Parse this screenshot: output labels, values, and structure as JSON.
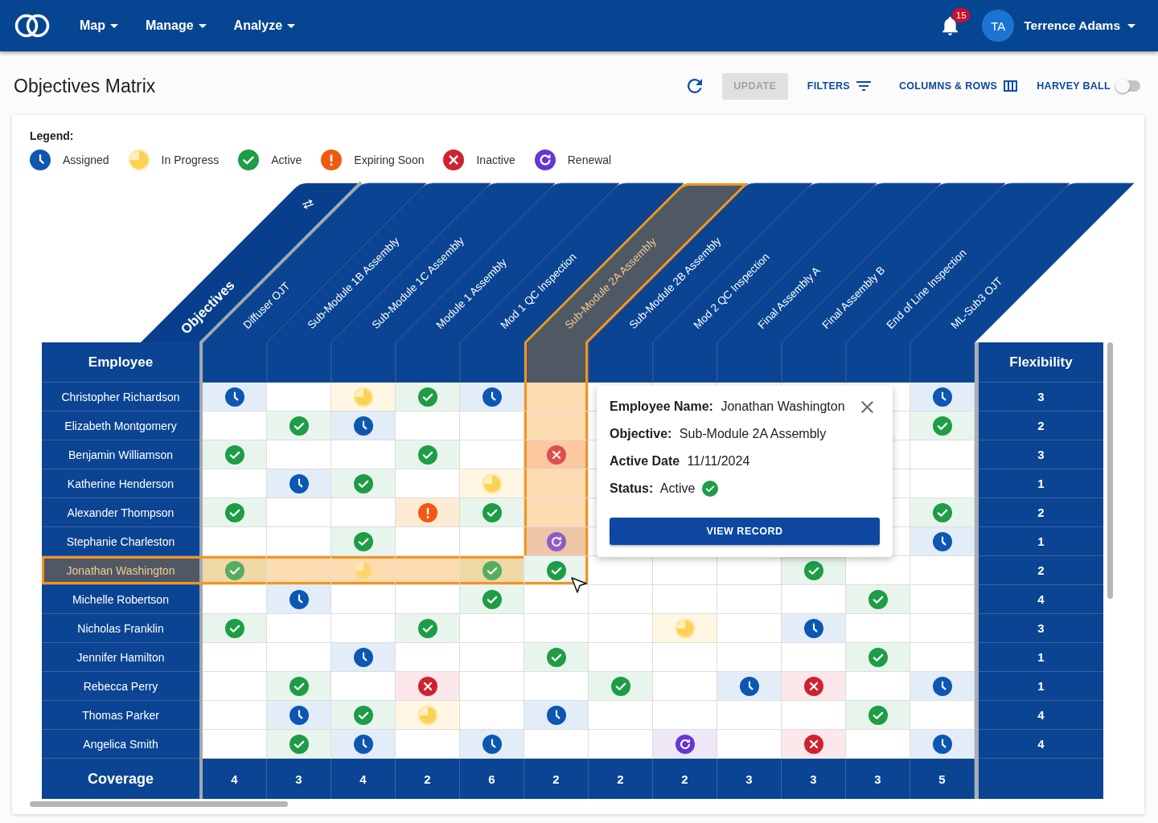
{
  "top_bar": {
    "nav": [
      "Map",
      "Manage",
      "Analyze"
    ],
    "notifications": "15",
    "user": {
      "initials": "TA",
      "name": "Terrence Adams"
    }
  },
  "page_title": "Objectives Matrix",
  "toolbar": {
    "update": {
      "label": "UPDATE",
      "disabled": true
    },
    "filters": "FILTERS",
    "columns_rows": "COLUMNS & ROWS",
    "harvey_ball": {
      "label": "HARVEY BALL",
      "on": false
    }
  },
  "legend": {
    "title": "Legend:",
    "items": [
      {
        "kind": "assigned",
        "label": "Assigned"
      },
      {
        "kind": "in_progress",
        "label": "In Progress"
      },
      {
        "kind": "active",
        "label": "Active"
      },
      {
        "kind": "expiring",
        "label": "Expiring Soon"
      },
      {
        "kind": "inactive",
        "label": "Inactive"
      },
      {
        "kind": "renewal",
        "label": "Renewal"
      }
    ]
  },
  "matrix": {
    "objectives_label": "Objectives",
    "employee_header": "Employee",
    "flexibility_header": "Flexibility",
    "columns": [
      {
        "label": "Diffuser OJT",
        "selected": false
      },
      {
        "label": "Sub-Module 1B Assembly",
        "selected": false
      },
      {
        "label": "Sub-Module 1C Assembly",
        "selected": false
      },
      {
        "label": "Module 1 Assembly",
        "selected": false
      },
      {
        "label": "Mod 1 QC Inspection",
        "selected": false
      },
      {
        "label": "Sub-Module 2A Assembly",
        "selected": true
      },
      {
        "label": "Sub-Module 2B Assembly",
        "selected": false
      },
      {
        "label": "Mod 2 QC Inspection",
        "selected": false
      },
      {
        "label": "Final Assembly A",
        "selected": false
      },
      {
        "label": "Final Assembly B",
        "selected": false
      },
      {
        "label": "End of Line Inspection",
        "selected": false
      },
      {
        "label": "ML-Sub3 OJT",
        "selected": false
      }
    ],
    "rows": [
      {
        "name": "Christopher Richardson",
        "selected": false,
        "cells": [
          {
            "kind": "assigned"
          },
          null,
          {
            "kind": "in_progress"
          },
          {
            "kind": "active"
          },
          {
            "kind": "assigned"
          },
          null,
          null,
          null,
          null,
          null,
          null,
          {
            "kind": "assigned"
          }
        ],
        "flexibility": "3"
      },
      {
        "name": "Elizabeth Montgomery",
        "selected": false,
        "cells": [
          null,
          {
            "kind": "active"
          },
          {
            "kind": "assigned"
          },
          null,
          null,
          null,
          null,
          null,
          null,
          null,
          null,
          {
            "kind": "active"
          }
        ],
        "flexibility": "2"
      },
      {
        "name": "Benjamin Williamson",
        "selected": false,
        "cells": [
          {
            "kind": "active"
          },
          null,
          null,
          {
            "kind": "active"
          },
          null,
          {
            "kind": "inactive"
          },
          null,
          null,
          null,
          null,
          null,
          null
        ],
        "flexibility": "3"
      },
      {
        "name": "Katherine Henderson",
        "selected": false,
        "cells": [
          null,
          {
            "kind": "assigned"
          },
          {
            "kind": "active"
          },
          null,
          {
            "kind": "in_progress"
          },
          null,
          null,
          null,
          null,
          null,
          null,
          null
        ],
        "flexibility": "1"
      },
      {
        "name": "Alexander Thompson",
        "selected": false,
        "cells": [
          {
            "kind": "active"
          },
          null,
          null,
          {
            "kind": "expiring"
          },
          {
            "kind": "active"
          },
          null,
          null,
          null,
          null,
          null,
          null,
          {
            "kind": "active"
          }
        ],
        "flexibility": "2"
      },
      {
        "name": "Stephanie Charleston",
        "selected": false,
        "cells": [
          null,
          null,
          {
            "kind": "active"
          },
          null,
          null,
          {
            "kind": "renewal"
          },
          null,
          null,
          null,
          null,
          null,
          {
            "kind": "assigned"
          }
        ],
        "flexibility": "1"
      },
      {
        "name": "Jonathan Washington",
        "selected": true,
        "cells": [
          {
            "kind": "active"
          },
          null,
          {
            "kind": "in_progress"
          },
          null,
          {
            "kind": "active"
          },
          {
            "kind": "active"
          },
          null,
          null,
          null,
          {
            "kind": "active"
          },
          null,
          null
        ],
        "flexibility": "2"
      },
      {
        "name": "Michelle Robertson",
        "selected": false,
        "cells": [
          null,
          {
            "kind": "assigned"
          },
          null,
          null,
          {
            "kind": "active"
          },
          null,
          null,
          null,
          null,
          null,
          {
            "kind": "active"
          },
          null
        ],
        "flexibility": "4"
      },
      {
        "name": "Nicholas Franklin",
        "selected": false,
        "cells": [
          {
            "kind": "active"
          },
          null,
          null,
          {
            "kind": "active"
          },
          null,
          null,
          null,
          {
            "kind": "in_progress"
          },
          null,
          {
            "kind": "assigned"
          },
          null,
          null
        ],
        "flexibility": "3"
      },
      {
        "name": "Jennifer Hamilton",
        "selected": false,
        "cells": [
          null,
          null,
          {
            "kind": "assigned"
          },
          null,
          null,
          {
            "kind": "active"
          },
          null,
          null,
          null,
          null,
          {
            "kind": "active"
          },
          null
        ],
        "flexibility": "1"
      },
      {
        "name": "Rebecca Perry",
        "selected": false,
        "cells": [
          null,
          {
            "kind": "active"
          },
          null,
          {
            "kind": "inactive"
          },
          null,
          null,
          {
            "kind": "active"
          },
          null,
          {
            "kind": "assigned"
          },
          {
            "kind": "inactive"
          },
          null,
          {
            "kind": "assigned"
          }
        ],
        "flexibility": "1"
      },
      {
        "name": "Thomas Parker",
        "selected": false,
        "cells": [
          null,
          {
            "kind": "assigned"
          },
          {
            "kind": "active"
          },
          {
            "kind": "in_progress"
          },
          null,
          {
            "kind": "assigned"
          },
          null,
          null,
          null,
          null,
          {
            "kind": "active"
          },
          null
        ],
        "flexibility": "4"
      },
      {
        "name": "Angelica Smith",
        "selected": false,
        "cells": [
          null,
          {
            "kind": "active"
          },
          {
            "kind": "assigned"
          },
          null,
          {
            "kind": "assigned"
          },
          null,
          null,
          {
            "kind": "renewal"
          },
          null,
          {
            "kind": "inactive"
          },
          null,
          {
            "kind": "assigned"
          }
        ],
        "flexibility": "4"
      }
    ],
    "coverage": {
      "label": "Coverage",
      "values": [
        "4",
        "3",
        "4",
        "2",
        "6",
        "2",
        "2",
        "2",
        "3",
        "3",
        "3",
        "5"
      ]
    }
  },
  "detail_popup": {
    "fields": [
      {
        "label": "Employee Name:",
        "value": "Jonathan Washington"
      },
      {
        "label": "Objective:",
        "value": "Sub-Module 2A Assembly"
      },
      {
        "label": "Active Date",
        "value": "11/11/2024"
      },
      {
        "label": "Status:",
        "value": "Active",
        "icon": {
          "kind": "active"
        }
      }
    ],
    "button": "VIEW RECORD"
  }
}
